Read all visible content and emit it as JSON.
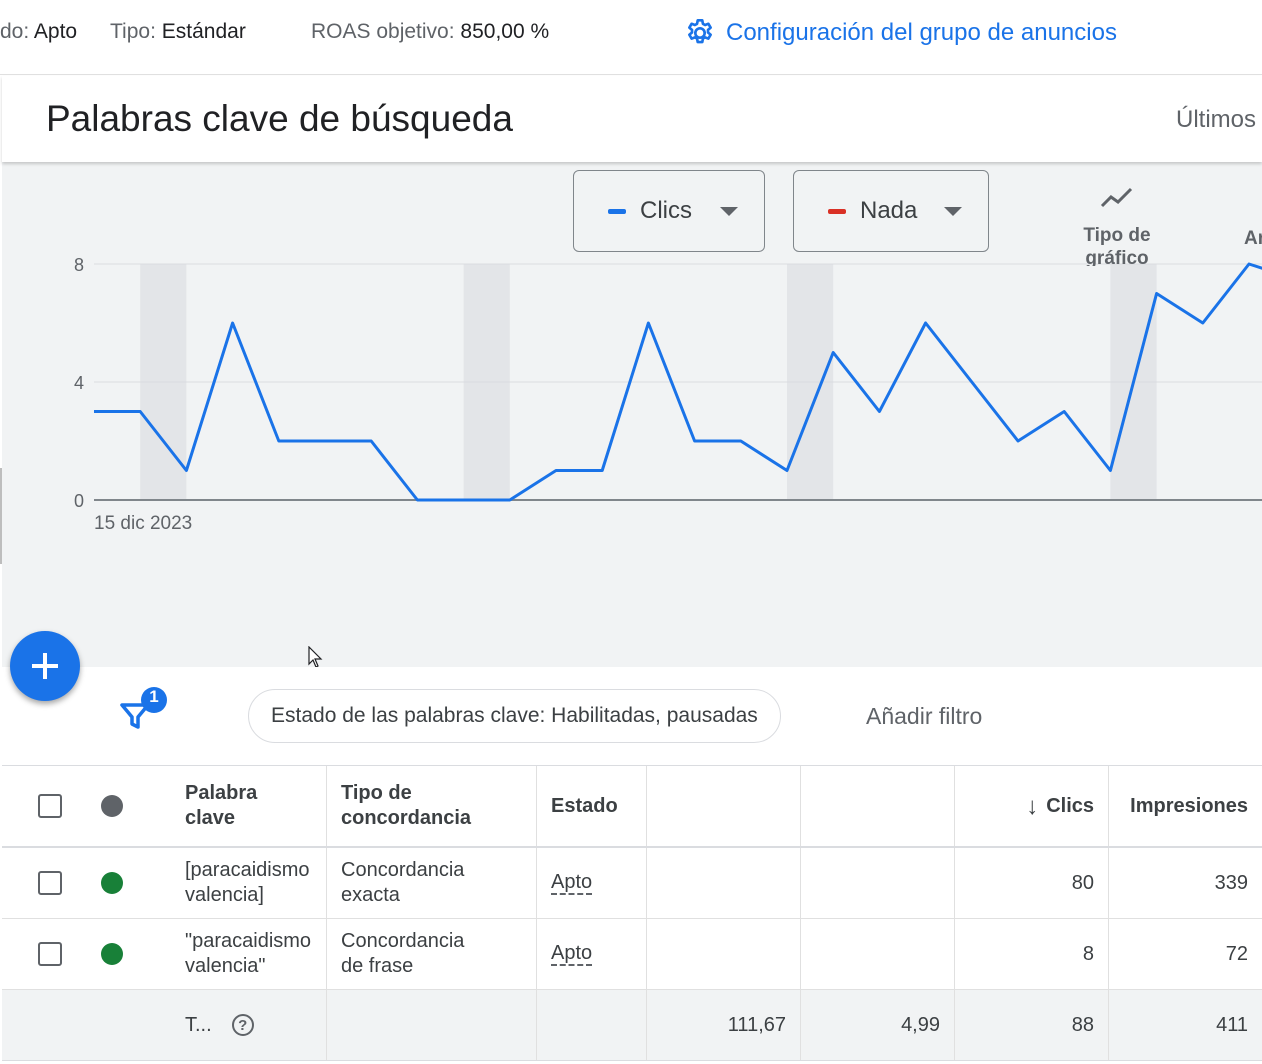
{
  "topbar": {
    "status_label": "do:",
    "status_value": "Apto",
    "type_label": "Tipo:",
    "type_value": "Estándar",
    "roas_label": "ROAS objetivo:",
    "roas_value": "850,00 %",
    "settings_link": "Configuración del grupo de anuncios",
    "settings_icon": "gear-icon",
    "accent_color": "#1a73e8"
  },
  "card": {
    "title": "Palabras clave de búsqueda",
    "period": "Últimos"
  },
  "chart_controls": {
    "metric1_label": "Clics",
    "metric1_color": "#1a73e8",
    "metric2_label": "Nada",
    "metric2_color": "#d93025",
    "chart_type_label": "Tipo de gráfico",
    "extra_label": "Ar"
  },
  "chart_data": {
    "type": "line",
    "series": [
      {
        "name": "Clics",
        "color": "#1a73e8",
        "values": [
          3,
          3,
          1,
          6,
          2,
          2,
          2,
          0,
          0,
          0,
          1,
          1,
          6,
          2,
          2,
          1,
          5,
          3,
          6,
          4,
          2,
          3,
          1,
          7,
          6,
          8,
          7.5
        ]
      }
    ],
    "x_tick_labels": [
      "15 dic 2023"
    ],
    "y_ticks": [
      0,
      4,
      8
    ],
    "ylim": [
      0,
      8
    ],
    "weekend_bands": [
      [
        1,
        2
      ],
      [
        8,
        9
      ],
      [
        15,
        16
      ],
      [
        22,
        23
      ]
    ],
    "grid": true
  },
  "fab_label": "+",
  "filters": {
    "count_badge": "1",
    "active_chip": "Estado de las palabras clave: Habilitadas, pausadas",
    "add_filter": "Añadir filtro"
  },
  "table": {
    "headers": {
      "keyword": "Palabra clave",
      "match_type": "Tipo de concordancia",
      "status": "Estado",
      "col4": "",
      "col5": "",
      "clicks": "Clics",
      "impressions": "Impresiones"
    },
    "sort_arrow": "↓",
    "rows": [
      {
        "status_color": "#188038",
        "keyword": "[paracaidismo valencia]",
        "match_type": "Concordancia exacta",
        "status": "Apto",
        "col4": "",
        "col5": "",
        "clicks": "80",
        "impressions": "339"
      },
      {
        "status_color": "#188038",
        "keyword": "\"paracaidismo valencia\"",
        "match_type": "Concordancia de frase",
        "status": "Apto",
        "col4": "",
        "col5": "",
        "clicks": "8",
        "impressions": "72"
      }
    ],
    "total": {
      "label": "T...",
      "col4": "111,67",
      "col5": "4,99",
      "clicks": "88",
      "impressions": "411"
    }
  }
}
